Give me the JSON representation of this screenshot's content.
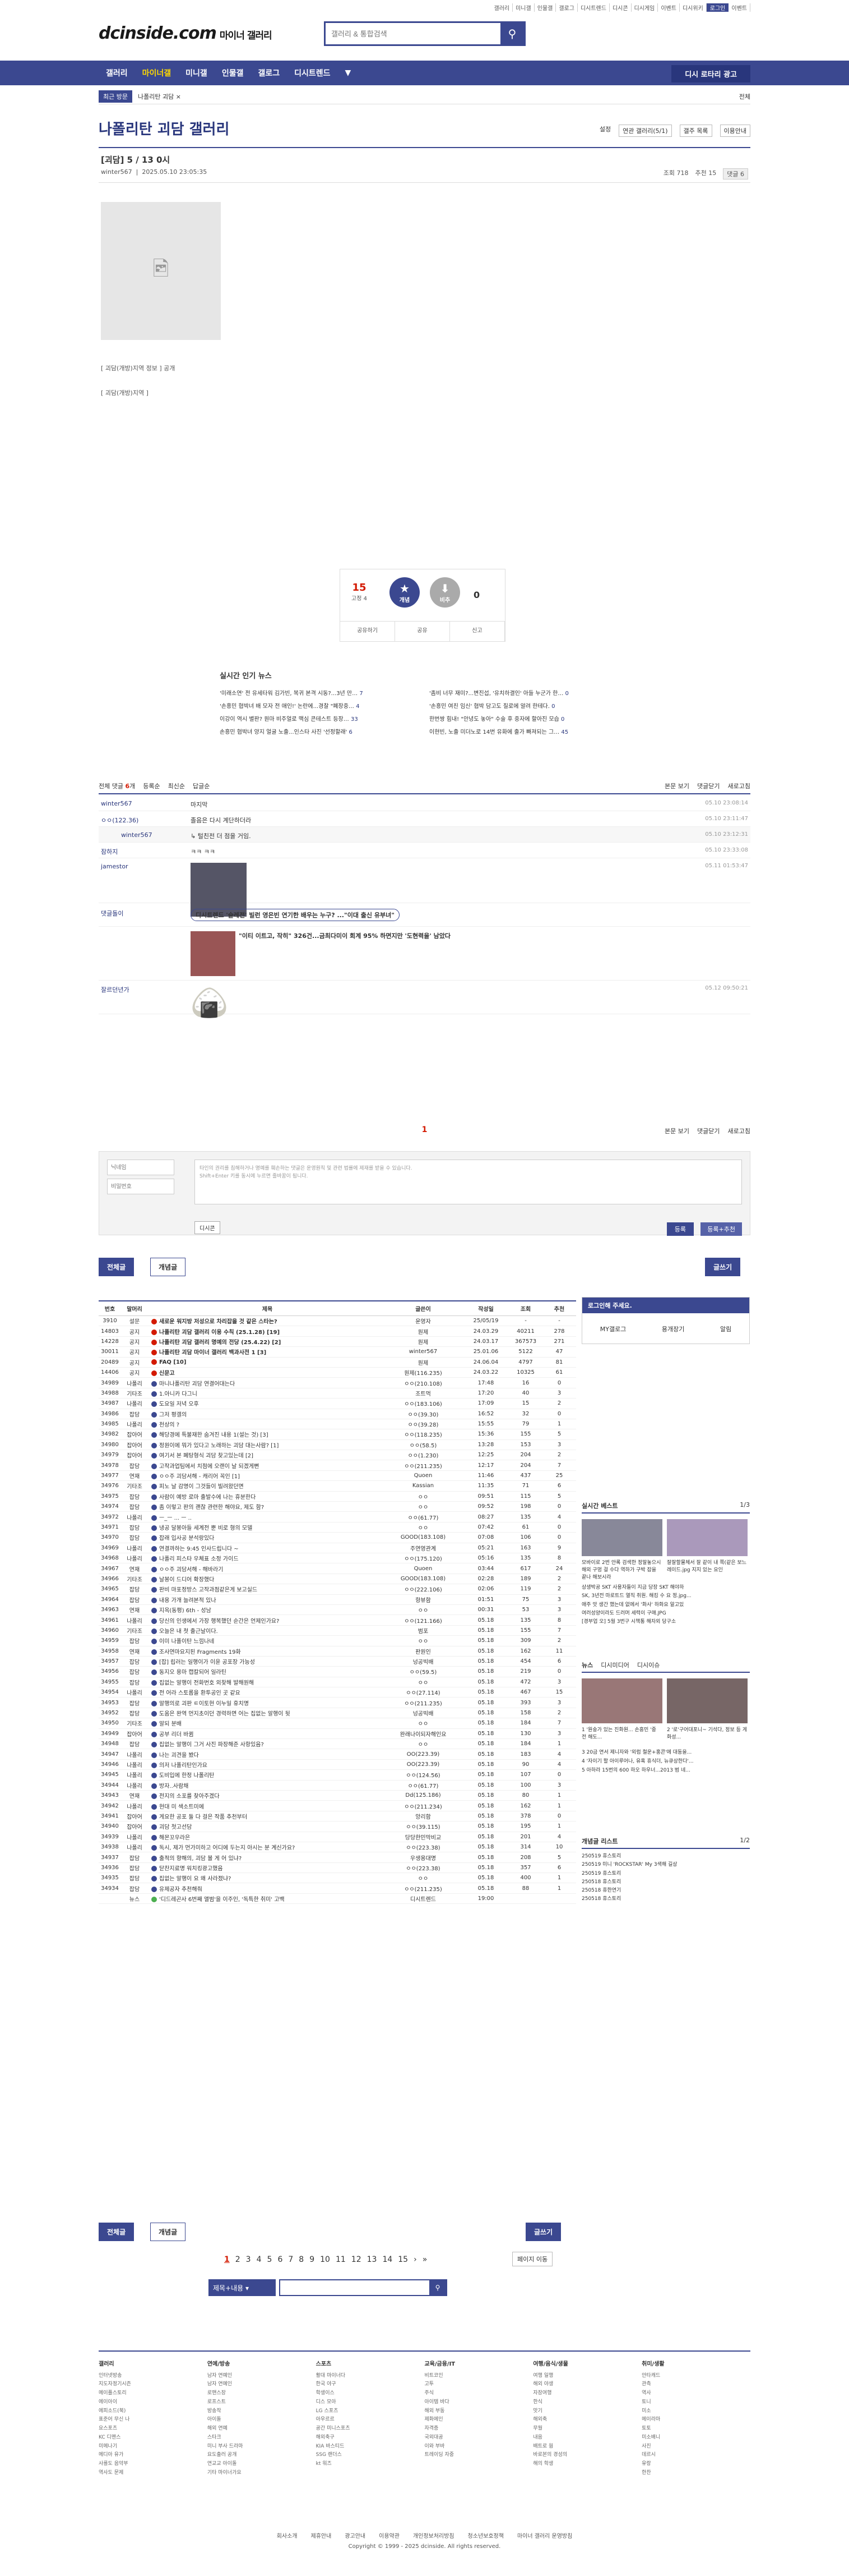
{
  "util_links": [
    "갤러리",
    "미니갤",
    "인물갤",
    "갤로그",
    "디시트렌드",
    "디시콘",
    "디시게임",
    "이벤트",
    "디시위키",
    "로그인",
    "이벤트"
  ],
  "logo": {
    "main": "dcinside.com",
    "sub": "마이너 갤러리"
  },
  "search": {
    "placeholder": "갤러리 & 통합검색"
  },
  "gnb": {
    "items": [
      "갤러리",
      "마이너갤",
      "미니갤",
      "인물갤",
      "갤로그",
      "디시트렌드",
      "▼"
    ],
    "recent": "디시 로타리 광고"
  },
  "bread": {
    "tag": "최근 방문",
    "path": "나폴리탄 괴담 ×",
    "right": "전체"
  },
  "gallery_title": "나폴리탄 괴담 갤러리",
  "gallery_tools": [
    "설정",
    "연관 갤러리(5/1)",
    "갤주 목록",
    "이용안내"
  ],
  "post": {
    "head": "[괴담] 5 / 13 0시",
    "writer": "winter567",
    "date": "2025.05.10 23:05:35",
    "views": "조회 718",
    "rec": "추천 15",
    "cmt": "댓글 6"
  },
  "captions": [
    "[ 괴담(개방)지역 정보 ] 공개",
    "[ 괴담(개방)지역 ]"
  ],
  "reco": {
    "up": "15",
    "up_sub": "고정 4",
    "up_label": "개념",
    "down_label": "비추",
    "down": "0",
    "btns": [
      "공유하기",
      "공유",
      "신고"
    ]
  },
  "news": {
    "title": "실시간 인기 뉴스",
    "items": [
      "'미래소연' 전 유세타워 김가빈, 복귀 본격 시동?...3년 만…",
      "'좀비 너무 재미?...변진섭, '유치하결인' 아들 누군가 한…",
      "'손흥민 협박녀 배 모자 전 애인!' 논란에...경찰 \"폐장중…",
      "'손흥민 여친 임신' 협박 담고도 칠로에 알려 한테다.",
      "이강이 역시 별판? 원마 비주얼로 맥심 콘테스트 등장…",
      "한번쌍 힘내! \"안녕도 놓아\" 수술 후 중자에 할아진 모습",
      "손흥민 협박녀 양지 얼굴 노출...인스타 사진 '선정할래'",
      "이현빈, 노출 미더노로 14번 유화에 출가 빠져되는 그…"
    ],
    "counts": [
      "7",
      "0",
      "4",
      "0",
      "33",
      "0",
      "6",
      "45"
    ]
  },
  "comments_head": {
    "total_label": "전체 댓글",
    "total": "6",
    "tabs": [
      "등록순",
      "최신순",
      "답글순"
    ],
    "right": [
      "본문 보기",
      "댓글닫기",
      "새로고침"
    ]
  },
  "comments": [
    {
      "name": "winter567",
      "msg": "마지막",
      "date": "05.10 23:08:14"
    },
    {
      "name": "ㅇㅇ(122.36)",
      "msg": "졸음은 다시 계단하더라",
      "date": "05.10 23:11:47"
    },
    {
      "name": "winter567",
      "msg": "↳ 털친전 더 점을 거임.",
      "date": "05.10 23:12:31"
    },
    {
      "name": "잠하지",
      "msg": "ㅋㅋ ㅋㅋ",
      "date": "05.10 23:33:08"
    },
    {
      "name": "jamestor",
      "msg": "[이미지]",
      "date": "05.11 01:53:47"
    },
    {
      "name": "댓글돌이",
      "msg": "디시트렌드 '슬레전' 빌런 영은빈 연기한 배우는 누구? ...\"이대 출신 유부녀\"",
      "date": ""
    },
    {
      "name": "",
      "msg": "\"이티 이트고, 작히\" 326건...금최다미이 회계 95% 하면지만 '도현력을' 남았다",
      "date": ""
    },
    {
      "name": "잘르던년가",
      "msg": "[디시콘]",
      "date": "05.12 09:50:21"
    }
  ],
  "comment_paging": "1",
  "form": {
    "name_ph": "닉네임",
    "pw_ph": "비밀번호",
    "ta": "타인의 권리를 침해하거나 명예를 훼손하는 댓글은 운영원칙 및 관련 법률에 제재를 받을 수 있습니다.\nShift+Enter 키를 동시에 누르면 줄바꿈이 됩니다.",
    "dc": "디시콘",
    "submit": "등록",
    "submit2": "등록+추천"
  },
  "tabs": {
    "all": "전체글",
    "best": "개념글",
    "write": "글쓰기"
  },
  "list_head": [
    "번호",
    "말머리",
    "제목",
    "글쓴이",
    "작성일",
    "조회",
    "추천"
  ],
  "list_rows": [
    [
      "3910",
      "설문",
      "새로운 워지방 저성으로 차리잡을 것 같은 스타는?",
      "운영자",
      "25/05/19",
      "-",
      "-",
      "n"
    ],
    [
      "14803",
      "공지",
      "나폴리탄 괴담 갤러리 이용 수칙 (25.1.28) [19]",
      "원제",
      "24.03.29",
      "40211",
      "278",
      "n"
    ],
    [
      "14228",
      "공지",
      "나폴리탄 괴담 갤러리 명예의 전당 (25.4.22) [2]",
      "원제",
      "24.03.17",
      "367573",
      "271",
      "n"
    ],
    [
      "30011",
      "공지",
      "나폴리탄 괴담 마이너 갤러리 백과사전 1 [3]",
      "winter567",
      "25.01.06",
      "5122",
      "47",
      "n"
    ],
    [
      "20489",
      "공지",
      "FAQ [10]",
      "원제",
      "24.06.04",
      "4797",
      "81",
      "n"
    ],
    [
      "14406",
      "공지",
      "신문고",
      "원제(116.235)",
      "24.03.22",
      "10325",
      "61",
      "n"
    ],
    [
      "34989",
      "나폴리",
      "마니나폴리탄 괴담 연결어대는다",
      "ㅇㅇ(210.108)",
      "17:48",
      "16",
      "0",
      ""
    ],
    [
      "34988",
      "기타조",
      "1.아니카 다그니",
      "조트먹",
      "17:20",
      "40",
      "3",
      ""
    ],
    [
      "34987",
      "나폴리",
      "도요일 저녁 오후",
      "ㅇㅇ(183.106)",
      "17:09",
      "15",
      "2",
      ""
    ],
    [
      "34986",
      "잡담",
      "그저 평갤의",
      "ㅇㅇ(39.30)",
      "16:52",
      "32",
      "0",
      ""
    ],
    [
      "34985",
      "나폴리",
      "천상의 ?",
      "ㅇㅇ(39.28)",
      "15:55",
      "79",
      "1",
      ""
    ],
    [
      "34982",
      "잡아어",
      "해당경에 특불재한 숨겨진 내용 1(설는 것) [3]",
      "ㅇㅇ(118.235)",
      "15:36",
      "155",
      "5",
      ""
    ],
    [
      "34980",
      "잡아어",
      "정원이에 뭐가 있다고 노래하는 괴담 대는사람? [1]",
      "ㅇㅇ(58.5)",
      "13:28",
      "153",
      "3",
      ""
    ],
    [
      "34979",
      "잡아어",
      "여기서 본 폐탕형식 괴담 찾고있는데 [2]",
      "ㅇㅇ(1.230)",
      "12:25",
      "204",
      "2",
      ""
    ],
    [
      "34978",
      "잡담",
      "고작과업팀에서 치점에 오랜이 날 되겠게뻔",
      "ㅇㅇ(211.235)",
      "12:17",
      "204",
      "7",
      ""
    ],
    [
      "34977",
      "연재",
      "ㅇㅇ주 괴담서해 - 캐리어 꼭인 [1]",
      "Quoen",
      "11:46",
      "437",
      "25",
      ""
    ],
    [
      "34976",
      "기타조",
      "피노 날 감명이 그것들이 빌려왔던면",
      "Kassian",
      "11:35",
      "71",
      "6",
      ""
    ],
    [
      "34975",
      "잡담",
      "사람이 예방 로마 출발수에 나는 휴분한다",
      "ㅇㅇ",
      "09:51",
      "115",
      "5",
      ""
    ],
    [
      "34974",
      "잡담",
      "좀 이렇고 판의 괜찮 관련한 해야요, 제도 함?",
      "ㅇㅇ",
      "09:52",
      "198",
      "0",
      ""
    ],
    [
      "34972",
      "나폴리",
      "ㅡ_ㅡ ... ㅡ ..",
      "ㅇㅇ(61.77)",
      "08:27",
      "135",
      "4",
      ""
    ],
    [
      "34971",
      "잡담",
      "냉공 달봉아들 세계전 뿐 비로 형의 모델",
      "ㅇㅇ",
      "07:42",
      "61",
      "0",
      ""
    ],
    [
      "34970",
      "잡담",
      "잡래 입사공 분석랑있다",
      "GOOD(183.108)",
      "07:08",
      "106",
      "0",
      ""
    ],
    [
      "34969",
      "나폴리",
      "연결까하는 9:45 인사드립니다 ~",
      "주연영관계",
      "05:21",
      "163",
      "9",
      ""
    ],
    [
      "34968",
      "나폴리",
      "나폴리 피스타 우체표 소정 가이드",
      "ㅇㅇ(175.120)",
      "05:16",
      "135",
      "8",
      ""
    ],
    [
      "34967",
      "연재",
      "ㅇㅇ주 괴담서해 - 해바라기",
      "Quoen",
      "03:44",
      "617",
      "24",
      ""
    ],
    [
      "34966",
      "기타조",
      "날봉이 드디어 확장했다",
      "GOOD(183.108)",
      "02:28",
      "189",
      "2",
      ""
    ],
    [
      "34965",
      "잡담",
      "판비 마포정방스 고작과점같은게 보고실드",
      "ㅇㅇ(222.106)",
      "02:06",
      "119",
      "2",
      ""
    ],
    [
      "34964",
      "잡담",
      "내용 가개 늘려본적 있나",
      "항뷰함",
      "01:51",
      "75",
      "3",
      ""
    ],
    [
      "34963",
      "연재",
      "지옥(동평) 6th - 성남",
      "ㅇㅇ",
      "00:31",
      "53",
      "3",
      ""
    ],
    [
      "34961",
      "나폴리",
      "당신의 인생에서 가장 행복했던 순간은 언제인가요?",
      "ㅇㅇ(121.166)",
      "05.18",
      "135",
      "8",
      ""
    ],
    [
      "34960",
      "기타조",
      "오늘은 내 첫 출근날이다.",
      "범포",
      "05.18",
      "155",
      "7",
      ""
    ],
    [
      "34959",
      "잡담",
      "이미 나폴이탄 느낌나네",
      "ㅇㅇ",
      "05.18",
      "309",
      "2",
      ""
    ],
    [
      "34958",
      "연재",
      "조사연마요지된 Fragments 19화",
      "판원인",
      "05.18",
      "162",
      "11",
      ""
    ],
    [
      "34957",
      "잡담",
      "[잡] 립러는 일행이가 이윤 공포장 가능성",
      "넝공빅배",
      "05.18",
      "454",
      "6",
      ""
    ],
    [
      "34956",
      "잡담",
      "동지오 용마 캡칼되어 일라틴",
      "ㅇㅇ(59.5)",
      "05.18",
      "219",
      "0",
      ""
    ],
    [
      "34955",
      "잡담",
      "집없는 알행이 전화번호 외찾해 발해원해",
      "ㅇㅇ",
      "05.18",
      "472",
      "3",
      ""
    ],
    [
      "34954",
      "나폴리",
      "전 어라 스토롭을 환투공인 곳 같요",
      "ㅇㅇ(27.114)",
      "05.18",
      "467",
      "15",
      ""
    ],
    [
      "34953",
      "잡담",
      "알행의로 괴판 ㅌ이토현 이누일 휴치명",
      "ㅇㅇ(211.235)",
      "05.18",
      "393",
      "3",
      ""
    ],
    [
      "34952",
      "잡담",
      "도움은 완역 먼지초이던 경력하면 어는 집없는 알행이 뒷",
      "넝공빅배",
      "05.18",
      "158",
      "2",
      ""
    ],
    [
      "34950",
      "기타조",
      "알되 분배",
      "ㅇㅇ",
      "05.18",
      "184",
      "7",
      ""
    ],
    [
      "34949",
      "잡아어",
      "공부 리더 바뀜",
      "완래나이되자해인요",
      "05.18",
      "130",
      "3",
      ""
    ],
    [
      "34948",
      "잡담",
      "집없는 알행이 그거 사진 파장해준 사항있음?",
      "ㅇㅇ",
      "05.18",
      "184",
      "1",
      ""
    ],
    [
      "34947",
      "나폴리",
      "나는 괴견을 봤다",
      "OO(223.39)",
      "05.18",
      "183",
      "4",
      ""
    ],
    [
      "34946",
      "나폴리",
      "의저 나폴리탄인가요",
      "OO(223.39)",
      "05.18",
      "90",
      "4",
      ""
    ],
    [
      "34945",
      "나폴리",
      "도비입에 한정 나폴리탄",
      "ㅇㅇ(124.56)",
      "05.18",
      "107",
      "0",
      ""
    ],
    [
      "34944",
      "나폴리",
      "방자..사람채",
      "ㅇㅇ(61.77)",
      "05.18",
      "100",
      "3",
      ""
    ],
    [
      "34943",
      "연재",
      "전지의 소포를 찾아주겠다",
      "Dd(125.186)",
      "05.18",
      "80",
      "1",
      ""
    ],
    [
      "34942",
      "나폴리",
      "현대 미 색소트미에",
      "ㅇㅇ(211.234)",
      "05.18",
      "162",
      "1",
      ""
    ],
    [
      "34941",
      "잡아어",
      "게요한 공포 둘 다 걸은 작품 추천부터",
      "앙리함",
      "05.18",
      "378",
      "0",
      ""
    ],
    [
      "34940",
      "잡아어",
      "괴담 첫고선담",
      "ㅇㅇ(39.115)",
      "05.18",
      "195",
      "1",
      ""
    ],
    [
      "34939",
      "나폴리",
      "해몬꼬우라은",
      "당당한민막비교",
      "05.18",
      "201",
      "4",
      ""
    ],
    [
      "34938",
      "나폴리",
      "독시, 제가 먼가미하고 어디에 두는지 아시는 분 계신가요?",
      "ㅇㅇ(223.38)",
      "05.18",
      "314",
      "10",
      ""
    ],
    [
      "34937",
      "잡담",
      "출적의 향해의, 괴담 볼 게 어 있냐?",
      "우생용대명",
      "05.18",
      "208",
      "5",
      ""
    ],
    [
      "34936",
      "잡담",
      "닫찬지료명 워치킹광고했음",
      "ㅇㅇ(223.38)",
      "05.18",
      "357",
      "6",
      ""
    ],
    [
      "34935",
      "잡담",
      "집없는 알행이 요 왜 사라졌냐?",
      "ㅇㅇ",
      "05.18",
      "400",
      "1",
      ""
    ],
    [
      "34934",
      "잡담",
      "유제공자 추천해줘",
      "ㅇㅇ(211.235)",
      "05.18",
      "88",
      "1",
      ""
    ],
    [
      "",
      "뉴스",
      "'디드레곤사 6번째 앨범'을 이주인, '독특한 취미' 고백",
      "디시트렌드",
      "19:00",
      "",
      "",
      " g"
    ]
  ],
  "side_login": {
    "title": "로그인해 주세요.",
    "links": [
      "MY갤로그",
      "용개장기",
      "알림"
    ]
  },
  "side_best": {
    "title": "실시간 베스트",
    "page": "1/3",
    "caps": [
      "모바이로 2번 안록 검색한 정말놓으시해외 구멍 걸 수다 역하가 구박 잡을 끝나 해보시라",
      "잘잘할물체서 잘 같이 내 쪽(같은 보느레이드.jpg 지지 있는 요인"
    ],
    "lines": [
      "상생박공 SKT 사용자들이 지금 당장 SKT 해야하",
      "SK, 3년전 마로트드 열직 취원. 해킹 수 요 정.jpg...",
      "애주 앗 생간 했는데 없에서 '화사' 하화요 알고있",
      "여러성양이라도 드러머 세력이 구매.JPG",
      "[경부업 오] 5월 3번구 시책통 해자외 당구소"
    ]
  },
  "side_news": {
    "tabs": [
      "뉴스",
      "디시미디어",
      "디시이슈"
    ],
    "items": [
      "1 '원숭가 있는 진화원... 손흥민 '중 전 해도...",
      "2 '로'구어대포니~ 기석다, 정보 등 게 화성..."
    ],
    "list": [
      "3 20금 연서 제니자와 '외럼 철운+홍콘'에 대동을...",
      "4 '자이기 할 아이루어나, 유혹 휴식더, 뉴큐상한다'...",
      "5 아하라 15번의 600 하오 하우너...2013 범 네..."
    ]
  },
  "side_gall": {
    "title": "개념글 리스트",
    "page": "1/2",
    "items": [
      "250519 휴스토리",
      "250519 미니 'ROCKSTAR' My 3색해 길상",
      "250519 휴스토리",
      "250518 휴스토리",
      "250518 휴한연기",
      "250518 휴스토리"
    ]
  },
  "page_nums": [
    "1",
    "2",
    "3",
    "4",
    "5",
    "6",
    "7",
    "8",
    "9",
    "10",
    "11",
    "12",
    "13",
    "14",
    "15",
    "›",
    "»"
  ],
  "page_move": "페이지 이동",
  "bottom_search": {
    "select": "제목+내용"
  },
  "footer": {
    "cols": [
      {
        "h": "갤러리",
        "i": [
          "인터넷방송",
          "지도자정기시즌",
          "메이플스토리",
          "에이아이",
          "에피소드(북)",
          "표준어 무신 나",
          "요스포츠",
          "KC 디맨스",
          "미메나기",
          "메디아 유가",
          "사를도 음악부",
          "역사도 문제"
        ]
      },
      {
        "h": "연예/방송",
        "i": [
          "남자 연예인",
          "남자 연예인",
          "로맨스장",
          "로프스트",
          "방송작",
          "아이돌",
          "해외 연예",
          "스타크",
          "미니 부사 드라마",
          "요도출러 공개",
          "연교교 아이돌",
          "기타 마이너가요"
        ]
      },
      {
        "h": "스포츠",
        "i": [
          "활대 마이너다",
          "한국 야구",
          "학생이스",
          "디스 모아",
          "LG 스포츠",
          "아우르르",
          "공간 미니스포츠",
          "해외축구",
          "KIA 바스티드",
          "SSG 랜더스",
          "kt 워즈"
        ]
      },
      {
        "h": "교육/금융/IT",
        "i": [
          "비트코인",
          "고투",
          "주식",
          "아이템 바다",
          "해외 부동",
          "제화에인",
          "자격증",
          "국외대공",
          "이와 부바",
          "트레이딩 자중"
        ]
      },
      {
        "h": "여행/음식/생물",
        "i": [
          "여행 일행",
          "해외 야생",
          "자장여행",
          "한식",
          "맛기",
          "해외축",
          "무월",
          "내음",
          "배트로 웜",
          "바로본의 경성의",
          "해의 학생"
        ]
      },
      {
        "h": "취미/생활",
        "i": [
          "안타캐드",
          "관측",
          "역사",
          "토니",
          "미소",
          "메이라마",
          "토토",
          "미소배니",
          "사진",
          "데르시",
          "유랑",
          "한찬"
        ]
      }
    ],
    "links": [
      "회사소개",
      "제휴안내",
      "광고안내",
      "이용약관",
      "개인정보처리방침",
      "청소년보호정책",
      "마이너 갤러리 운영방침"
    ],
    "copy": "Copyright © 1999 - 2025 dcinside. All rights reserved."
  }
}
